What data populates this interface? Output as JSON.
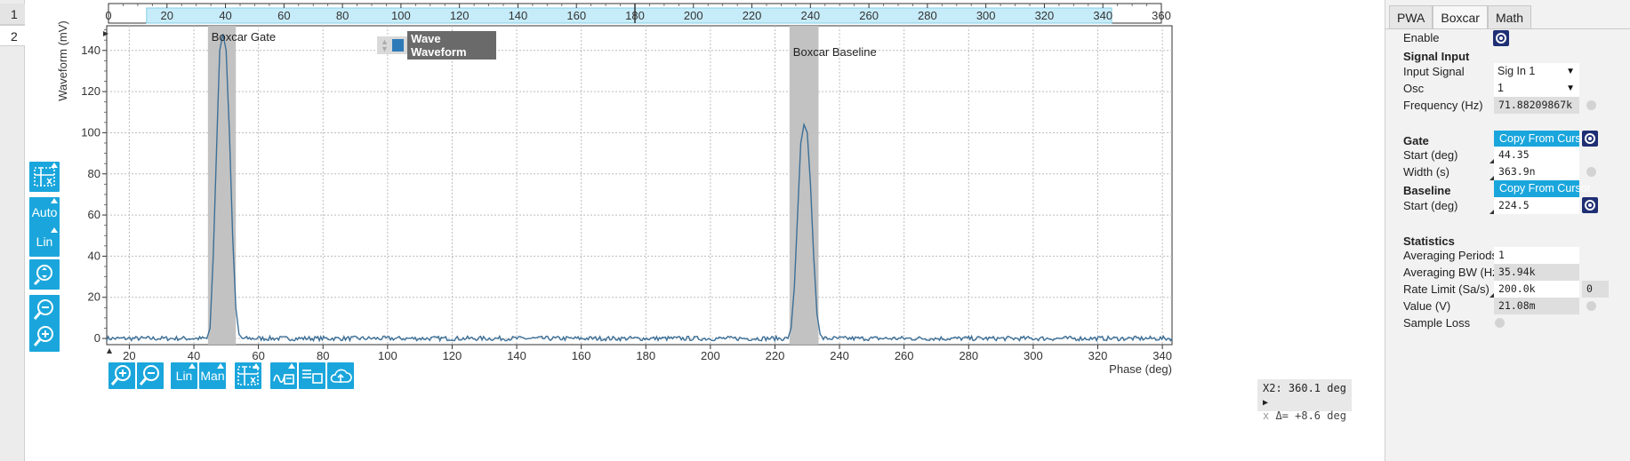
{
  "side_tabs": [
    "1",
    "2"
  ],
  "plot": {
    "top_axis_ticks": [
      "0",
      "20",
      "40",
      "60",
      "80",
      "100",
      "120",
      "140",
      "160",
      "180",
      "200",
      "220",
      "240",
      "260",
      "280",
      "300",
      "320",
      "340",
      "360"
    ],
    "bottom_axis_ticks": [
      "20",
      "40",
      "60",
      "80",
      "100",
      "120",
      "140",
      "160",
      "180",
      "200",
      "220",
      "240",
      "260",
      "280",
      "300",
      "320",
      "340"
    ],
    "y_axis_ticks": [
      "0",
      "20",
      "40",
      "60",
      "80",
      "100",
      "120",
      "140"
    ],
    "y_label": "Waveform (mV)",
    "x_label": "Phase (deg)",
    "gate_label": "Boxcar Gate",
    "baseline_label": "Boxcar Baseline",
    "legend_label": "Wave Waveform",
    "cursor_x2": "X2: 360.1 deg",
    "cursor_delta": "Δ= +8.6 deg"
  },
  "chart_data": {
    "type": "line",
    "xlabel": "Phase (deg)",
    "ylabel": "Waveform (mV)",
    "xlim": [
      13,
      343
    ],
    "ylim": [
      -3,
      152
    ],
    "grid": true,
    "series": [
      {
        "name": "Wave Waveform",
        "x": [
          13,
          40,
          44,
          45,
          46,
          47,
          48,
          49,
          50,
          51,
          52,
          53,
          54,
          55,
          100,
          150,
          200,
          224,
          225,
          226,
          227,
          228,
          229,
          230,
          231,
          232,
          233,
          234,
          235,
          280,
          343
        ],
        "y": [
          0,
          0,
          0,
          5,
          40,
          90,
          140,
          148,
          140,
          100,
          50,
          15,
          2,
          0,
          0,
          0,
          0,
          0,
          5,
          25,
          60,
          95,
          104,
          100,
          75,
          40,
          12,
          2,
          0,
          0,
          0
        ]
      }
    ],
    "gate_region": [
      44.35,
      53
    ],
    "baseline_region": [
      224.5,
      233.5
    ]
  },
  "toolbar_left": {
    "auto_label": "Auto",
    "lin_label": "Lin"
  },
  "toolbar_bottom": {
    "lin_label": "Lin",
    "man_label": "Man"
  },
  "panel": {
    "tabs": [
      "PWA",
      "Boxcar",
      "Math"
    ],
    "enable_label": "Enable",
    "signal_input_header": "Signal Input",
    "input_signal_label": "Input Signal",
    "input_signal_value": "Sig In 1",
    "osc_label": "Osc",
    "osc_value": "1",
    "frequency_label": "Frequency (Hz)",
    "frequency_value": "71.88209867k",
    "gate_header": "Gate",
    "copy_from_cursors_label": "Copy From Cursors",
    "start_deg_label": "Start (deg)",
    "gate_start_value": "44.35",
    "width_label": "Width (s)",
    "width_value": "363.9n",
    "baseline_header": "Baseline",
    "copy_from_cursor_label": "Copy From Cursor",
    "baseline_start_label": "Start (deg)",
    "baseline_start_value": "224.5",
    "statistics_header": "Statistics",
    "averaging_periods_label": "Averaging Periods",
    "averaging_periods_value": "1",
    "averaging_bw_label": "Averaging BW (Hz)",
    "averaging_bw_value": "35.94k",
    "rate_limit_label": "Rate Limit (Sa/s)",
    "rate_limit_value": "200.0k",
    "rate_limit_actual": "0",
    "value_label": "Value (V)",
    "value_value": "21.08m",
    "sample_loss_label": "Sample Loss"
  }
}
